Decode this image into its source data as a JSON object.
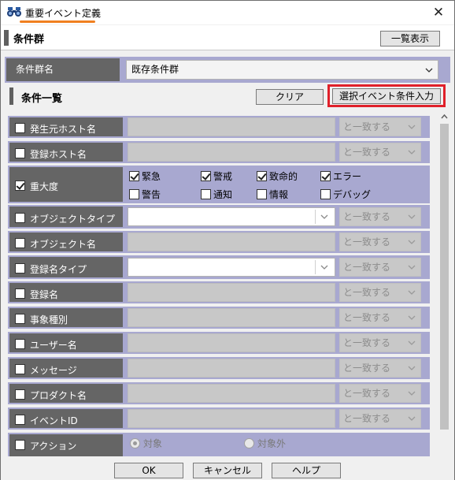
{
  "window": {
    "title": "重要イベント定義",
    "close_glyph": "✕",
    "accent_color": "#f08020"
  },
  "section": {
    "title": "条件群",
    "list_view_button": "一覧表示"
  },
  "group": {
    "label": "条件群名",
    "selected": "既存条件群"
  },
  "conditions": {
    "title": "条件一覧",
    "clear_button": "クリア",
    "selected_event_button": "選択イベント条件入力",
    "highlight_color": "#e0202a"
  },
  "match_text": "と一致する",
  "rows": [
    {
      "label": "発生元ホスト名",
      "checked": false
    },
    {
      "label": "登録ホスト名",
      "checked": false
    },
    {
      "label": "重大度",
      "checked": true
    },
    {
      "label": "オブジェクトタイプ",
      "checked": false
    },
    {
      "label": "オブジェクト名",
      "checked": false
    },
    {
      "label": "登録名タイプ",
      "checked": false
    },
    {
      "label": "登録名",
      "checked": false
    },
    {
      "label": "事象種別",
      "checked": false
    },
    {
      "label": "ユーザー名",
      "checked": false
    },
    {
      "label": "メッセージ",
      "checked": false
    },
    {
      "label": "プロダクト名",
      "checked": false
    },
    {
      "label": "イベントID",
      "checked": false
    },
    {
      "label": "アクション",
      "checked": false
    }
  ],
  "severity": [
    {
      "label": "緊急",
      "checked": true
    },
    {
      "label": "警戒",
      "checked": true
    },
    {
      "label": "致命的",
      "checked": true
    },
    {
      "label": "エラー",
      "checked": true
    },
    {
      "label": "警告",
      "checked": false
    },
    {
      "label": "通知",
      "checked": false
    },
    {
      "label": "情報",
      "checked": false
    },
    {
      "label": "デバッグ",
      "checked": false
    }
  ],
  "action": {
    "options": [
      {
        "label": "対象",
        "selected": true
      },
      {
        "label": "対象外",
        "selected": false
      }
    ]
  },
  "footer": {
    "ok": "OK",
    "cancel": "キャンセル",
    "help": "ヘルプ"
  }
}
